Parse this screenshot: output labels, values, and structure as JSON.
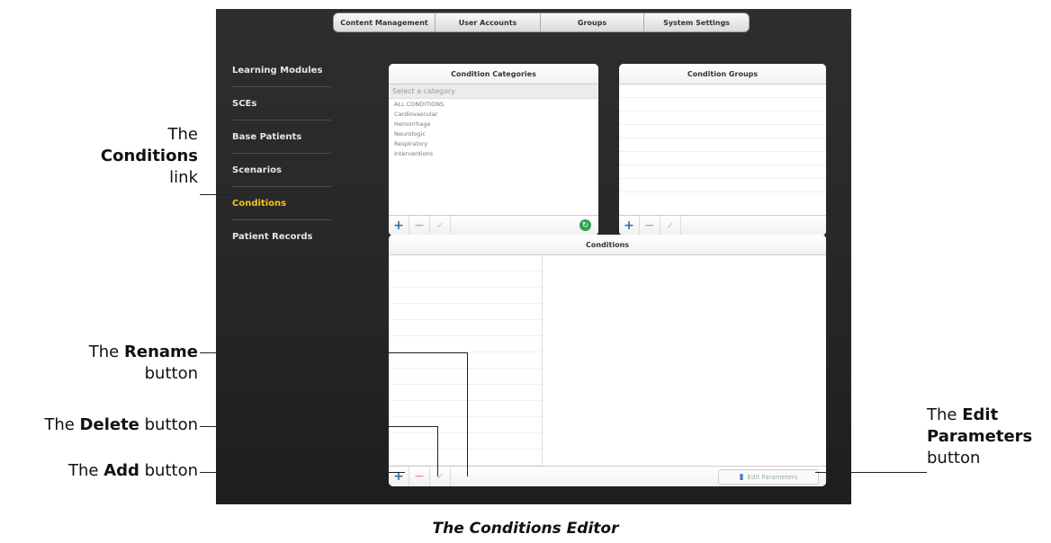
{
  "nav": {
    "tabs": [
      "Content Management",
      "User Accounts",
      "Groups",
      "System Settings"
    ]
  },
  "sidebar": {
    "items": [
      {
        "label": "Learning Modules",
        "active": false
      },
      {
        "label": "SCEs",
        "active": false
      },
      {
        "label": "Base Patients",
        "active": false
      },
      {
        "label": "Scenarios",
        "active": false
      },
      {
        "label": "Conditions",
        "active": true
      },
      {
        "label": "Patient Records",
        "active": false
      }
    ],
    "active_color": "#f0c419"
  },
  "condition_categories": {
    "title": "Condition Categories",
    "placeholder": "Select a category",
    "items": [
      "ALL CONDITIONS",
      "Cardiovascular",
      "Hemorrhage",
      "Neurologic",
      "Respiratory",
      "Interventions"
    ]
  },
  "condition_groups": {
    "title": "Condition Groups"
  },
  "conditions": {
    "title": "Conditions",
    "edit_parameters_label": "Edit Parameters"
  },
  "toolbar_icons": {
    "add": "+",
    "delete": "−",
    "rename": "✓",
    "refresh": "↻",
    "edit_parameters": "bar-chart-icon"
  },
  "callouts": {
    "conditions_link": {
      "prefix": "The",
      "bold": "Conditions",
      "suffix": "link"
    },
    "rename": {
      "prefix": "The",
      "bold": "Rename",
      "suffix": "button"
    },
    "delete": {
      "prefix": "The",
      "bold": "Delete",
      "suffix": "button"
    },
    "add": {
      "prefix": "The",
      "bold": "Add",
      "suffix": "button"
    },
    "edit_parameters": {
      "prefix": "The",
      "bold1": "Edit",
      "bold2": "Parameters",
      "suffix": "button"
    }
  },
  "caption": "The Conditions Editor"
}
